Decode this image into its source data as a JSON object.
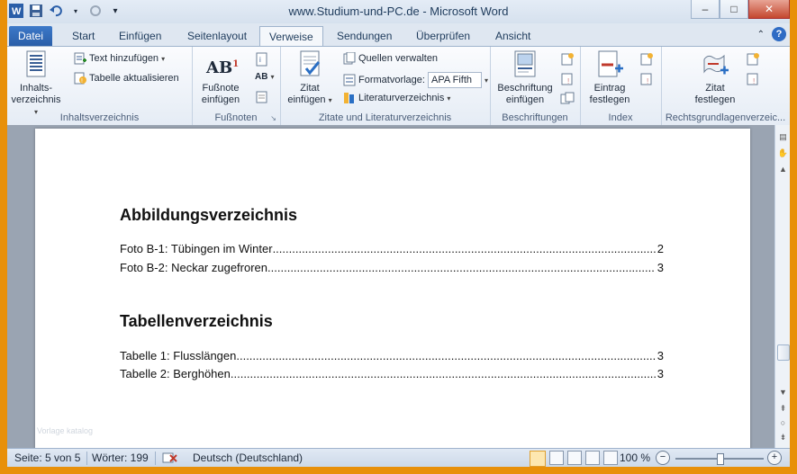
{
  "window": {
    "title": "www.Studium-und-PC.de - Microsoft Word",
    "minimize": "–",
    "maximize": "□",
    "close": "✕"
  },
  "tabs": [
    "Datei",
    "Start",
    "Einfügen",
    "Seitenlayout",
    "Verweise",
    "Sendungen",
    "Überprüfen",
    "Ansicht"
  ],
  "active_tab": "Verweise",
  "ribbon": {
    "inhaltsverzeichnis": {
      "big_line1": "Inhalts-",
      "big_line2": "verzeichnis",
      "text_hinzufuegen": "Text hinzufügen",
      "tabelle_aktualisieren": "Tabelle aktualisieren",
      "label": "Inhaltsverzeichnis"
    },
    "fussnoten": {
      "big_line1": "Fußnote",
      "big_line2": "einfügen",
      "icon_text": "AB",
      "sup": "1",
      "small_ab": "AB",
      "label": "Fußnoten"
    },
    "zitate": {
      "zitat_line1": "Zitat",
      "zitat_line2": "einfügen",
      "quellen": "Quellen verwalten",
      "formatvorlage_label": "Formatvorlage:",
      "formatvorlage_value": "APA Fifth",
      "literatur": "Literaturverzeichnis",
      "label": "Zitate und Literaturverzeichnis"
    },
    "beschriftungen": {
      "line1": "Beschriftung",
      "line2": "einfügen",
      "label": "Beschriftungen"
    },
    "index": {
      "line1": "Eintrag",
      "line2": "festlegen",
      "label": "Index"
    },
    "rechtsgrundlagen": {
      "line1": "Zitat",
      "line2": "festlegen",
      "label": "Rechtsgrundlagenverzeic..."
    }
  },
  "document": {
    "heading1": "Abbildungsverzeichnis",
    "figures": [
      {
        "text": "Foto B-1: Tübingen im Winter",
        "page": "2"
      },
      {
        "text": "Foto B-2: Neckar zugefroren",
        "page": "3"
      }
    ],
    "heading2": "Tabellenverzeichnis",
    "tables": [
      {
        "text": "Tabelle 1: Flusslängen",
        "page": "3"
      },
      {
        "text": "Tabelle 2: Berghöhen",
        "page": "3"
      }
    ],
    "watermark": "Vorlage katalog"
  },
  "status": {
    "page": "Seite: 5 von 5",
    "words": "Wörter: 199",
    "language": "Deutsch (Deutschland)",
    "zoom": "100 %",
    "zoom_value": 100
  },
  "colors": {
    "accent": "#2a5ea8",
    "frame": "#e8900a"
  }
}
